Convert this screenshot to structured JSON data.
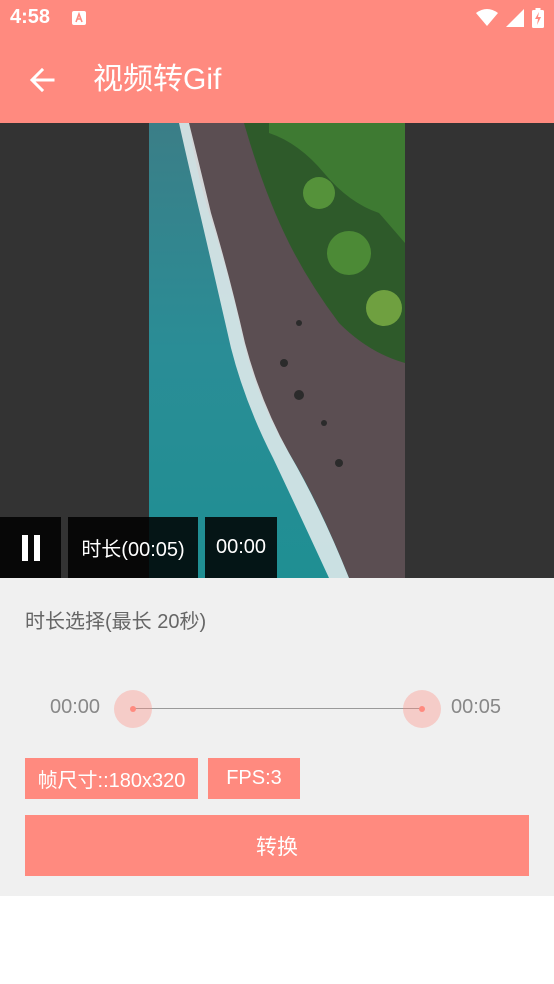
{
  "status_bar": {
    "time": "4:58",
    "icons": [
      "app-notification-icon",
      "wifi-icon",
      "signal-icon",
      "battery-charging-icon"
    ]
  },
  "app_bar": {
    "back_icon": "arrow-left-icon",
    "title": "视频转Gif"
  },
  "video": {
    "pause_icon": "pause-icon",
    "duration_label": "时长(00:05)",
    "position_label": "00:00"
  },
  "duration_select": {
    "label": "时长选择(最长 20秒)",
    "start_time": "00:00",
    "end_time": "00:05"
  },
  "options": {
    "frame_size": "帧尺寸::180x320",
    "fps": "FPS:3"
  },
  "convert_button": "转换",
  "colors": {
    "accent": "#ff8a7f",
    "video_bg": "#333333",
    "panel_bg": "#f0f0f0"
  }
}
